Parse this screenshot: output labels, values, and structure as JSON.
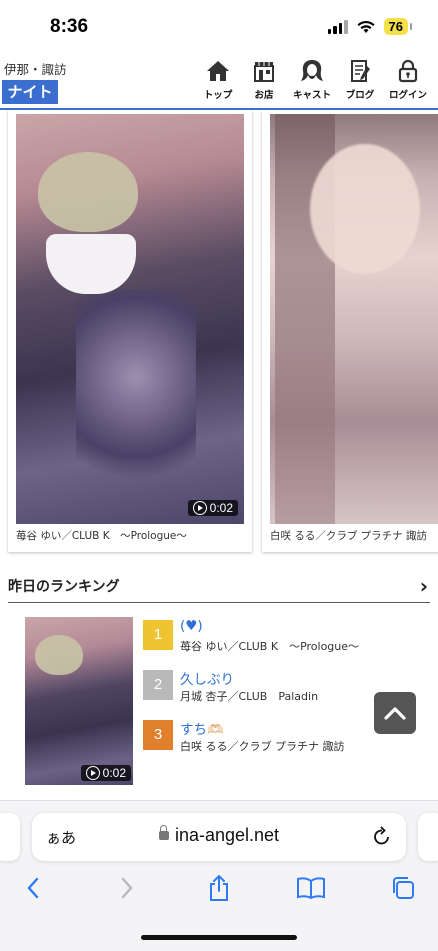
{
  "status": {
    "time": "8:36",
    "battery": "76"
  },
  "header": {
    "area": "伊那・諏訪",
    "badge": "ナイト",
    "nav": [
      {
        "label": "トップ",
        "icon": "home-icon"
      },
      {
        "label": "お店",
        "icon": "shop-icon"
      },
      {
        "label": "キャスト",
        "icon": "cast-icon"
      },
      {
        "label": "ブログ",
        "icon": "blog-icon"
      },
      {
        "label": "ログイン",
        "icon": "lock-icon"
      }
    ]
  },
  "cards": [
    {
      "caption": "苺谷 ゆい／CLUB K　〜Prologue〜",
      "duration": "0:02"
    },
    {
      "caption": "白咲 るる／クラブ プラチナ 諏訪",
      "duration": ""
    }
  ],
  "ranking": {
    "title": "昨日のランキング",
    "thumb_duration": "0:02",
    "items": [
      {
        "rank": "1",
        "color": "#f0c430",
        "title": "(♥)",
        "sub": "苺谷 ゆい／CLUB K　〜Prologue〜"
      },
      {
        "rank": "2",
        "color": "#b9b9b9",
        "title": "久しぶり",
        "sub": "月城 杏子／CLUB　Paladin"
      },
      {
        "rank": "3",
        "color": "#e07f2c",
        "title": "すち🫶🏻",
        "sub": "白咲 るる／クラブ プラチナ 諏訪"
      }
    ]
  },
  "browser": {
    "aa": "ぁあ",
    "url": "ina-angel.net"
  },
  "colors": {
    "accent": "#3a6fd0",
    "ios_blue": "#2f7bf6"
  }
}
